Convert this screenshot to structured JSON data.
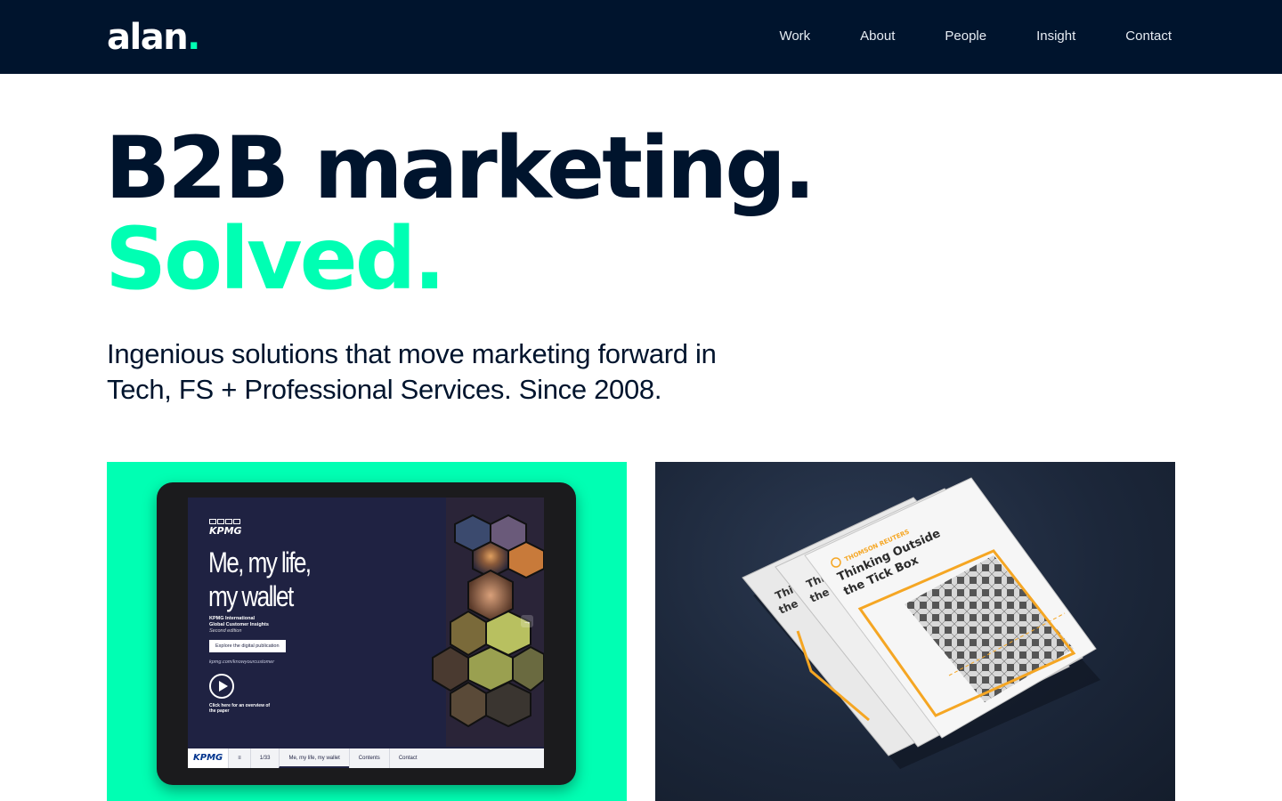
{
  "header": {
    "logo": "alan",
    "logo_dot": ".",
    "nav": [
      "Work",
      "About",
      "People",
      "Insight",
      "Contact"
    ]
  },
  "hero": {
    "line1": "B2B marketing.",
    "line2": "Solved.",
    "intro": "Ingenious solutions that move marketing forward in Tech, FS + Professional Services. Since 2008."
  },
  "cards": {
    "kpmg": {
      "logo": "KPMG",
      "title_line1": "Me, my life,",
      "title_line2": "my wallet",
      "subtitle_line1": "KPMG International",
      "subtitle_line2": "Global Customer Insights",
      "subtitle_edition": "Second edition",
      "button": "Explore the digital publication",
      "url": "kpmg.com/knowyourcustomer",
      "click_text": "Click here for an overview of the paper",
      "bar_logo": "KPMG",
      "bar_page": "1/33",
      "bar_items": [
        "Me, my life, my wallet",
        "Contents",
        "Contact"
      ]
    },
    "thomson": {
      "brand": "THOMSON REUTERS",
      "title_line1": "Thinking Outside",
      "title_line2": "the Tick Box"
    }
  },
  "colors": {
    "navy": "#00142d",
    "accent": "#00ffb3",
    "orange": "#f5a623"
  }
}
